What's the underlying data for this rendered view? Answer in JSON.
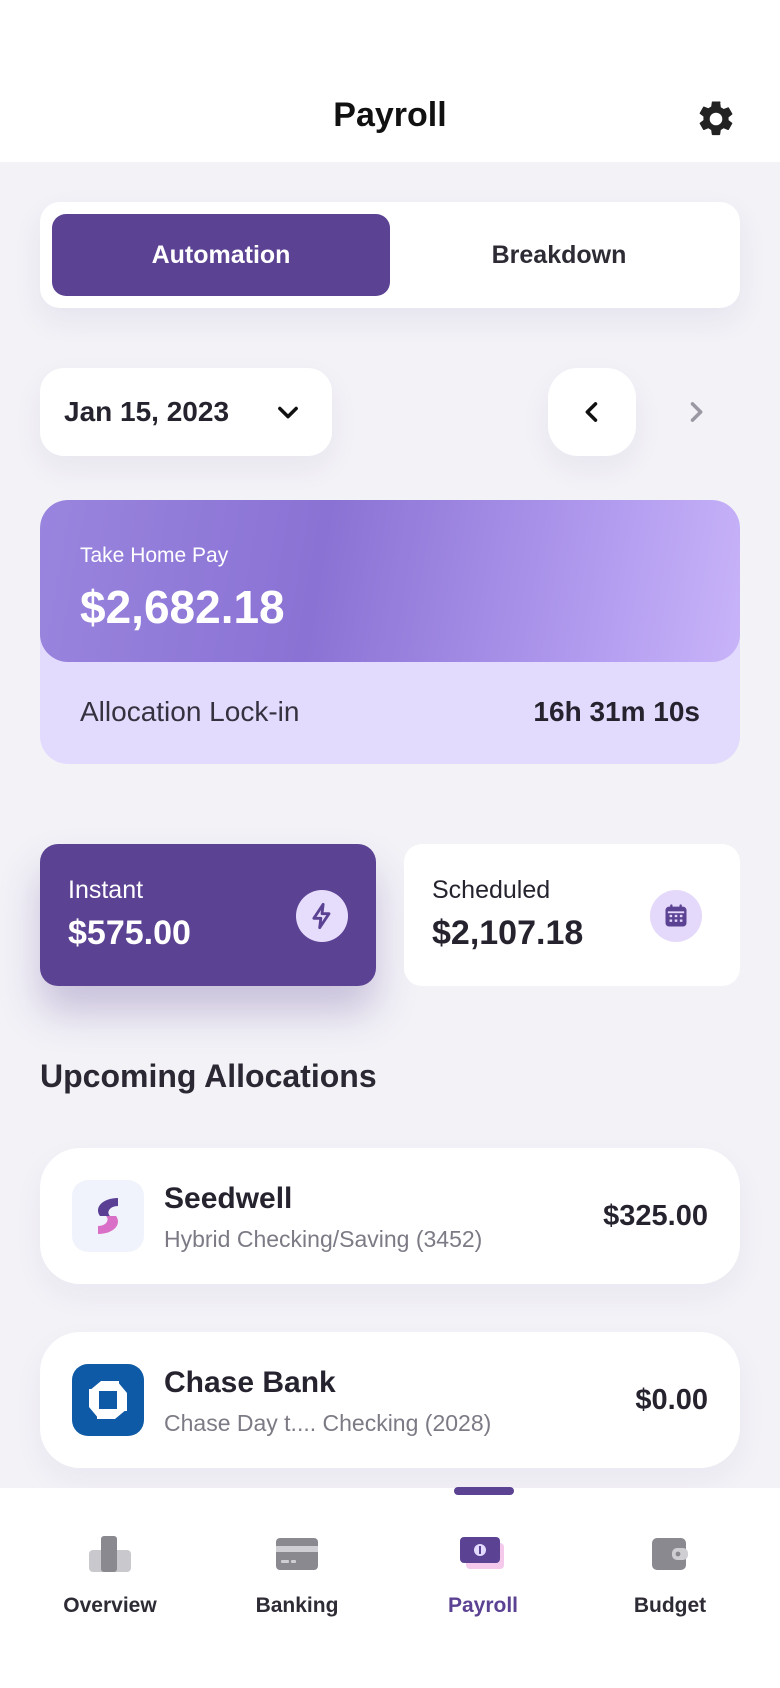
{
  "header": {
    "title": "Payroll",
    "settings_icon": "gear-icon"
  },
  "segmented": {
    "automation_label": "Automation",
    "breakdown_label": "Breakdown",
    "selected": "Automation"
  },
  "date_selector": {
    "value": "Jan 15, 2023",
    "dropdown_icon": "chevron-down-icon",
    "prev_icon": "chevron-left-icon",
    "next_icon": "chevron-right-icon"
  },
  "pay_card": {
    "label": "Take Home Pay",
    "amount": "$2,682.18",
    "lock_label": "Allocation Lock-in",
    "lock_time": "16h 31m 10s"
  },
  "stats": {
    "instant": {
      "label": "Instant",
      "value": "$575.00",
      "icon": "lightning-icon"
    },
    "scheduled": {
      "label": "Scheduled",
      "value": "$2,107.18",
      "icon": "calendar-icon"
    }
  },
  "upcoming": {
    "title": "Upcoming Allocations",
    "items": [
      {
        "name": "Seedwell",
        "account": "Hybrid Checking/Saving (3452)",
        "amount": "$325.00",
        "logo": "seedwell-logo"
      },
      {
        "name": "Chase Bank",
        "account": "Chase Day t.... Checking (2028)",
        "amount": "$0.00",
        "logo": "chase-logo"
      }
    ]
  },
  "bottom_nav": {
    "items": [
      {
        "label": "Overview",
        "icon": "overview-icon"
      },
      {
        "label": "Banking",
        "icon": "card-icon"
      },
      {
        "label": "Payroll",
        "icon": "money-icon"
      },
      {
        "label": "Budget",
        "icon": "wallet-icon"
      }
    ],
    "active": "Payroll"
  },
  "colors": {
    "accent": "#5b4293",
    "background": "#f3f2f7",
    "card_light_purple": "#e3dbfd",
    "gradient_start": "#9985de",
    "gradient_end": "#c8b4f9"
  }
}
